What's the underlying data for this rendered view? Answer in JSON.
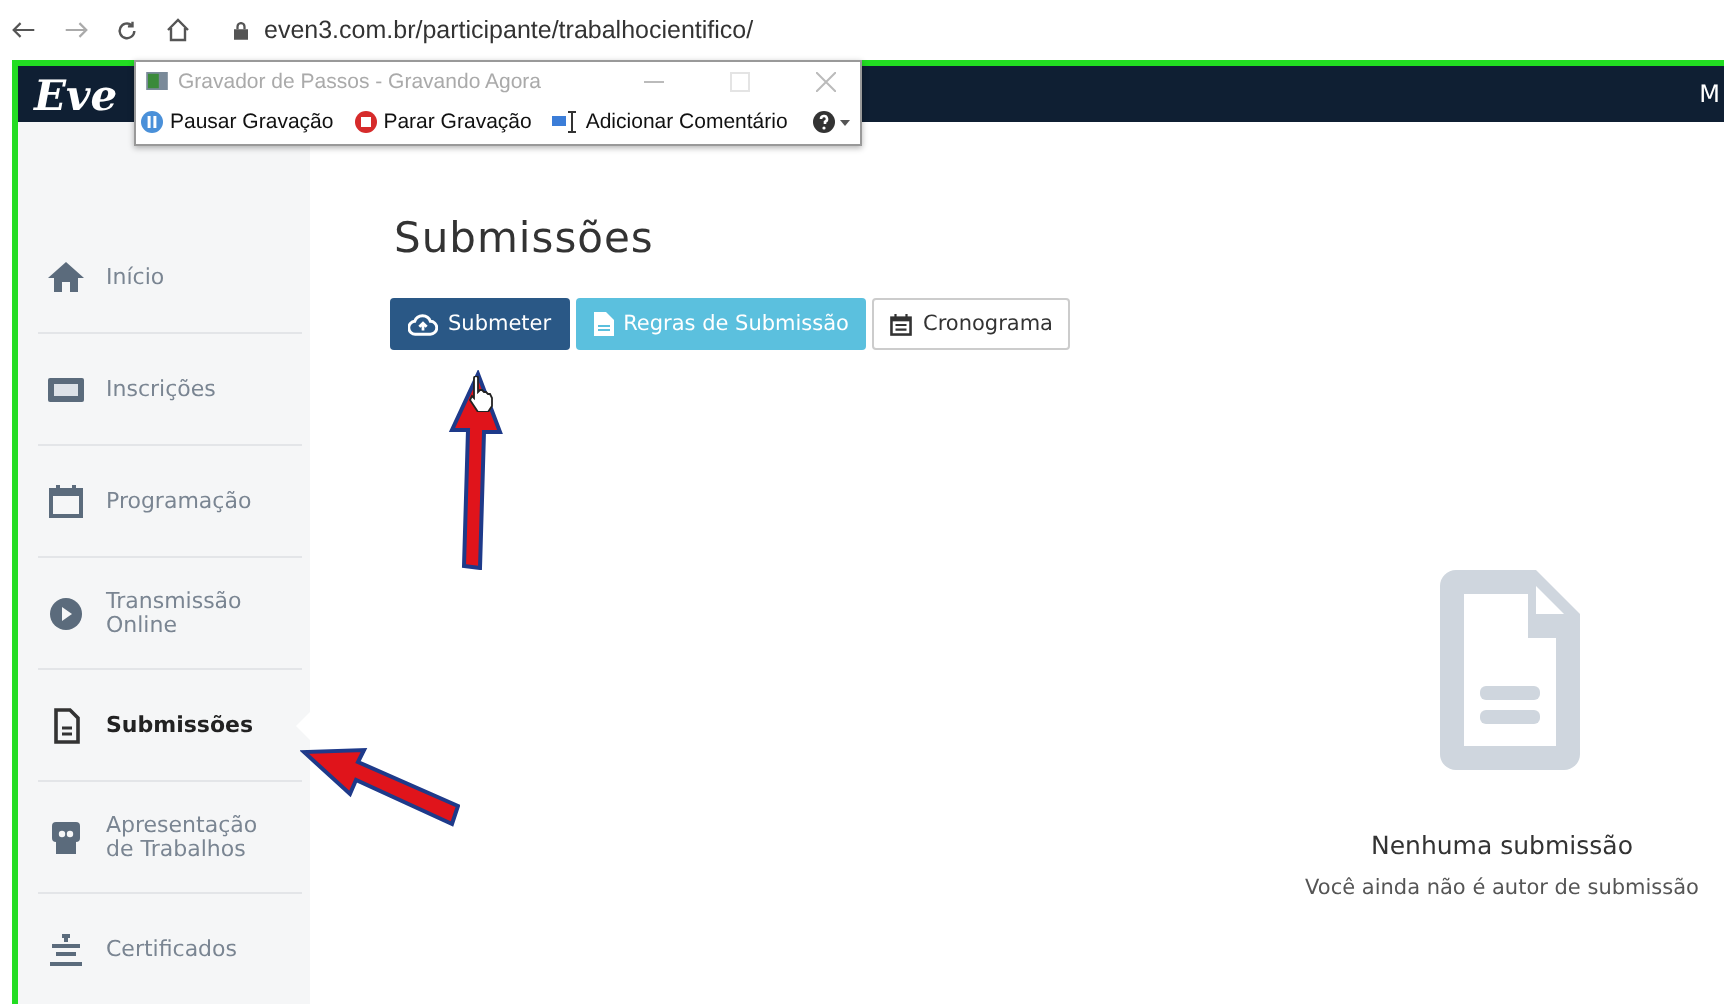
{
  "browser": {
    "url": "even3.com.br/participante/trabalhocientifico/"
  },
  "recorder": {
    "title": "Gravador de Passos - Gravando Agora",
    "buttons": [
      {
        "kind": "pause",
        "label": "Pausar Gravação"
      },
      {
        "kind": "stop",
        "label": "Parar Gravação"
      },
      {
        "kind": "comment",
        "label": "Adicionar Comentário"
      }
    ]
  },
  "header": {
    "logo": "Eve",
    "user": "M"
  },
  "sidebar": {
    "items": [
      {
        "kind": "home",
        "label": "Início",
        "selected": false
      },
      {
        "kind": "ticket",
        "label": "Inscrições",
        "selected": false
      },
      {
        "kind": "calendar",
        "label": "Programação",
        "selected": false
      },
      {
        "kind": "play",
        "label": "Transmissão Online",
        "selected": false
      },
      {
        "kind": "file",
        "label": "Submissões",
        "selected": true
      },
      {
        "kind": "presenter",
        "label": "Apresentação de Trabalhos",
        "selected": false
      },
      {
        "kind": "certificate",
        "label": "Certificados",
        "selected": false
      }
    ]
  },
  "page": {
    "title": "Submissões",
    "buttons": [
      {
        "kind": "primary",
        "label": "Submeter"
      },
      {
        "kind": "info",
        "label": "Regras de Submissão"
      },
      {
        "kind": "default",
        "label": "Cronograma"
      }
    ],
    "empty_state": {
      "title": "Nenhuma submissão",
      "message": "Você ainda não é autor de submissão"
    }
  }
}
